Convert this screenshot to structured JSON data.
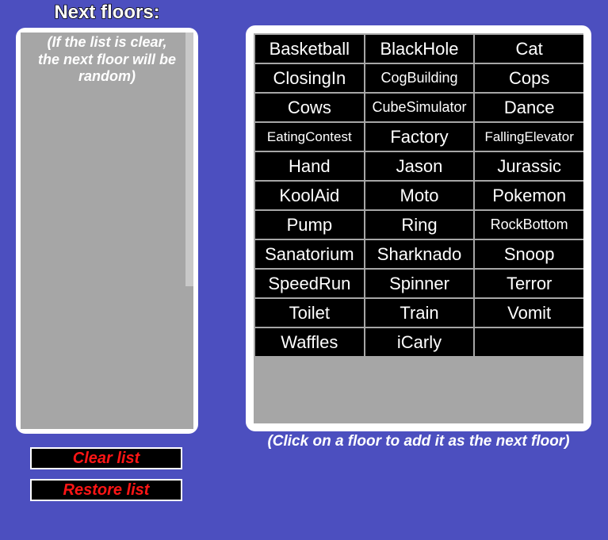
{
  "title": "Next floors:",
  "queue": {
    "hint_line1": "(If the list is clear,",
    "hint_line2": "the next floor will be",
    "hint_line3": "random)"
  },
  "buttons": {
    "clear": "Clear list",
    "restore": "Restore list"
  },
  "floorsHint": "(Click on a floor to add it as the next floor)",
  "floors": [
    "Basketball",
    "BlackHole",
    "Cat",
    "ClosingIn",
    "CogBuilding",
    "Cops",
    "Cows",
    "CubeSimulator",
    "Dance",
    "EatingContest",
    "Factory",
    "FallingElevator",
    "Hand",
    "Jason",
    "Jurassic",
    "KoolAid",
    "Moto",
    "Pokemon",
    "Pump",
    "Ring",
    "RockBottom",
    "Sanatorium",
    "Sharknado",
    "Snoop",
    "SpeedRun",
    "Spinner",
    "Terror",
    "Toilet",
    "Train",
    "Vomit",
    "Waffles",
    "iCarly",
    ""
  ]
}
